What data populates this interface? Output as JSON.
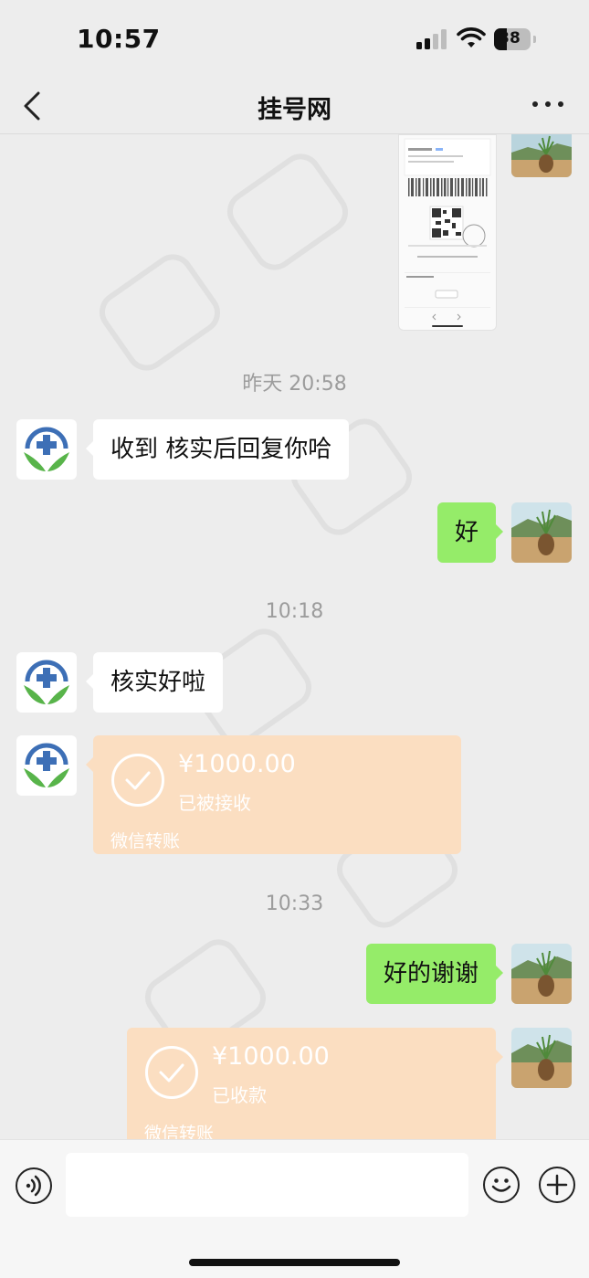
{
  "status_bar": {
    "time": "10:57",
    "battery": "38"
  },
  "nav": {
    "title": "挂号网"
  },
  "messages": {
    "timestamp1": "昨天 20:58",
    "msg1": "收到  核实后回复你哈",
    "msg2": "好",
    "timestamp2": "10:18",
    "msg3": "核实好啦",
    "transfer1": {
      "amount": "¥1000.00",
      "status": "已被接收",
      "label": "微信转账"
    },
    "timestamp3": "10:33",
    "msg4": "好的谢谢",
    "transfer2": {
      "amount": "¥1000.00",
      "status": "已收款",
      "label": "微信转账"
    }
  },
  "icons": {
    "back": "chevron-left-icon",
    "more": "more-dots-icon",
    "voice": "voice-icon",
    "emoji": "emoji-icon",
    "plus": "plus-icon"
  },
  "colors": {
    "background": "#ededed",
    "outgoing_bubble": "#95ec69",
    "incoming_bubble": "#ffffff",
    "transfer_card": "#fbdec1",
    "timestamp": "#9c9c9c"
  }
}
